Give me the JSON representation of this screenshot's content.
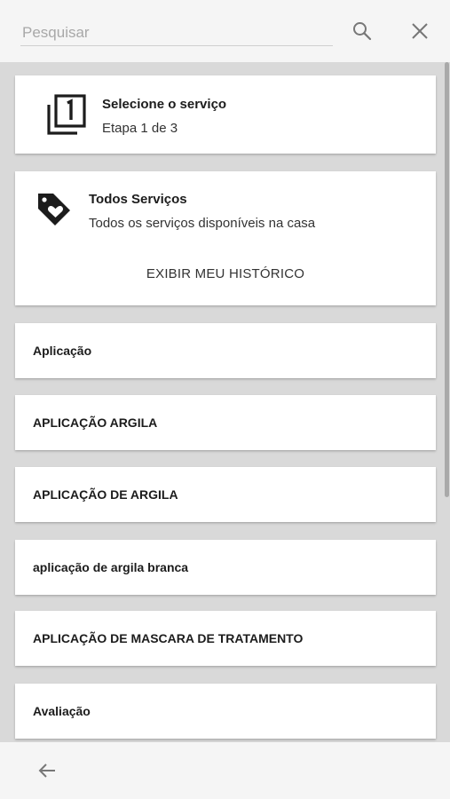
{
  "search": {
    "placeholder": "Pesquisar",
    "value": ""
  },
  "step": {
    "title": "Selecione o serviço",
    "subtitle": "Etapa 1 de 3",
    "icon": "filter-1-icon"
  },
  "all_services": {
    "title": "Todos Serviços",
    "subtitle": "Todos os serviços disponíveis na casa",
    "history_label": "EXIBIR MEU HISTÓRICO",
    "icon": "tag-heart-icon"
  },
  "services": [
    "Aplicação",
    "APLICAÇÃO ARGILA",
    "APLICAÇÃO DE ARGILA",
    "aplicação de argila branca",
    "APLICAÇÃO DE MASCARA DE TRATAMENTO",
    "Avaliação"
  ],
  "colors": {
    "background": "#d9d9d9",
    "bar": "#f5f5f5",
    "card": "#ffffff",
    "icon": "#1c1c1c"
  }
}
